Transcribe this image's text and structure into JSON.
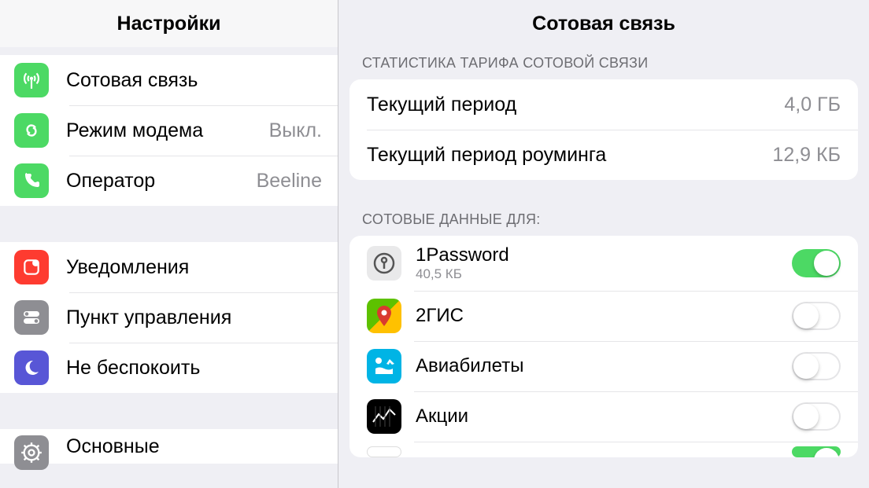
{
  "sidebar": {
    "title": "Настройки",
    "groups": [
      {
        "items": [
          {
            "id": "cellular",
            "label": "Сотовая связь",
            "value": ""
          },
          {
            "id": "hotspot",
            "label": "Режим модема",
            "value": "Выкл."
          },
          {
            "id": "carrier",
            "label": "Оператор",
            "value": "Beeline"
          }
        ]
      },
      {
        "items": [
          {
            "id": "notifications",
            "label": "Уведомления",
            "value": ""
          },
          {
            "id": "control-center",
            "label": "Пункт управления",
            "value": ""
          },
          {
            "id": "dnd",
            "label": "Не беспокоить",
            "value": ""
          }
        ]
      },
      {
        "items": [
          {
            "id": "general",
            "label": "Основные",
            "value": ""
          }
        ]
      }
    ]
  },
  "main": {
    "title": "Сотовая связь",
    "stats_header": "СТАТИСТИКА ТАРИФА СОТОВОЙ СВЯЗИ",
    "stats": [
      {
        "label": "Текущий период",
        "value": "4,0 ГБ"
      },
      {
        "label": "Текущий период роуминга",
        "value": "12,9 КБ"
      }
    ],
    "apps_header": "СОТОВЫЕ ДАННЫЕ ДЛЯ:",
    "apps": [
      {
        "id": "1password",
        "name": "1Password",
        "sub": "40,5 КБ",
        "on": true
      },
      {
        "id": "2gis",
        "name": "2ГИС",
        "sub": "",
        "on": false
      },
      {
        "id": "skyscanner",
        "name": "Авиабилеты",
        "sub": "",
        "on": false
      },
      {
        "id": "stocks",
        "name": "Акции",
        "sub": "",
        "on": false
      }
    ]
  }
}
